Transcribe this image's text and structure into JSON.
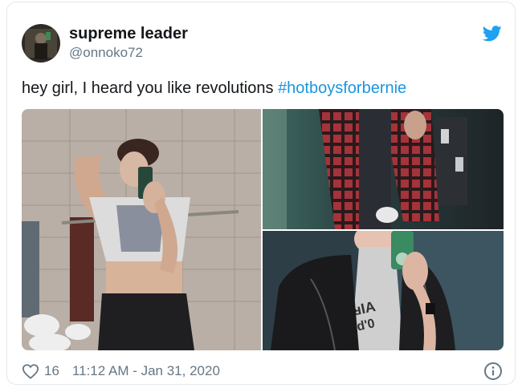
{
  "user": {
    "name": "supreme leader",
    "handle": "@onnoko72"
  },
  "tweet": {
    "text": "hey girl, I heard you like revolutions ",
    "hashtag": "#hotboysforbernie"
  },
  "media": {
    "photos": [
      {
        "icon": "mirror-selfie-photo"
      },
      {
        "icon": "flannel-shirt-photo"
      },
      {
        "icon": "leather-jacket-photo"
      }
    ]
  },
  "footer": {
    "likes": "16",
    "timestamp": "11:12 AM - Jan 31, 2020"
  },
  "colors": {
    "brand": "#1da1f2",
    "hashtag": "#1b95e0",
    "muted": "#657786",
    "text": "#14171a",
    "border": "#e1e8ed"
  },
  "icons": {
    "logo": "twitter-bird-icon",
    "like": "heart-icon",
    "info": "info-icon"
  }
}
